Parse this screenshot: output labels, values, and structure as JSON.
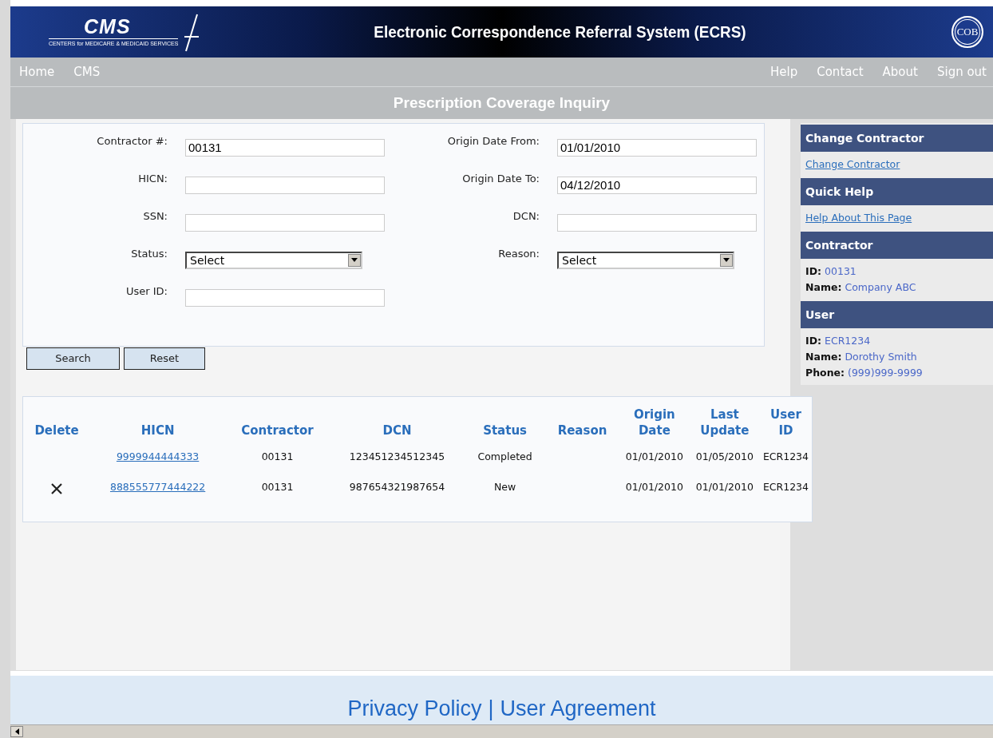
{
  "header": {
    "logo_text": "CMS",
    "logo_caption": "CENTERS for MEDICARE & MEDICAID SERVICES",
    "title": "Electronic Correspondence Referral System (ECRS)",
    "badge_text": "COB"
  },
  "nav": {
    "left": [
      "Home",
      "CMS"
    ],
    "right": [
      "Help",
      "Contact",
      "About",
      "Sign out"
    ]
  },
  "page_title": "Prescription Coverage Inquiry",
  "form": {
    "left": [
      {
        "kind": "text",
        "label": "Contractor #:",
        "value": "00131"
      },
      {
        "kind": "text",
        "label": "HICN:"
      },
      {
        "kind": "text",
        "label": "SSN:"
      },
      {
        "kind": "select",
        "label": "Status:",
        "value": "Select"
      },
      {
        "kind": "text",
        "label": "User ID:"
      }
    ],
    "right": [
      {
        "kind": "text",
        "label": "Origin Date From:",
        "value": "01/01/2010"
      },
      {
        "kind": "text",
        "label": "Origin Date To:",
        "value": "04/12/2010"
      },
      {
        "kind": "text",
        "label": "DCN:"
      },
      {
        "kind": "select",
        "label": "Reason:",
        "value": "Select"
      }
    ]
  },
  "buttons": [
    "Search",
    "Reset"
  ],
  "results": {
    "columns": [
      "Delete",
      "HICN",
      "Contractor",
      "DCN",
      "Status",
      "Reason",
      "Origin Date",
      "Last Update",
      "User ID"
    ],
    "rows": [
      {
        "deletable": false,
        "hicn": "9999944444333",
        "contractor": "00131",
        "dcn": "123451234512345",
        "status": "Completed",
        "origin_date": "01/01/2010",
        "last_update": "01/05/2010",
        "user_id": "ECR1234"
      },
      {
        "deletable": true,
        "hicn": "888555777444222",
        "contractor": "00131",
        "dcn": "987654321987654",
        "status": "New",
        "origin_date": "01/01/2010",
        "last_update": "01/01/2010",
        "user_id": "ECR1234"
      }
    ]
  },
  "sidebar": [
    {
      "kind": "links",
      "title": "Change Contractor",
      "links": [
        "Change Contractor"
      ]
    },
    {
      "kind": "links",
      "title": "Quick Help",
      "links": [
        "Help About This Page"
      ]
    },
    {
      "kind": "fields",
      "title": "Contractor",
      "fields": [
        {
          "label": "ID:",
          "value": "00131"
        },
        {
          "label": "Name:",
          "value": "Company ABC"
        }
      ]
    },
    {
      "kind": "fields",
      "title": "User",
      "fields": [
        {
          "label": "ID:",
          "value": "ECR1234"
        },
        {
          "label": "Name:",
          "value": "Dorothy Smith"
        },
        {
          "label": "Phone:",
          "value": "(999)999-9999"
        }
      ]
    }
  ],
  "footer": {
    "links": [
      "Privacy Policy",
      "User Agreement"
    ],
    "separator": "|"
  }
}
